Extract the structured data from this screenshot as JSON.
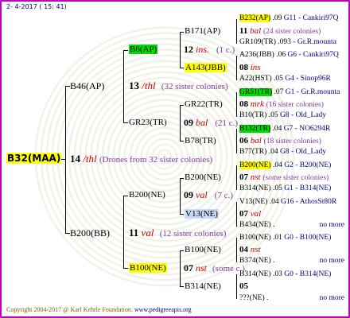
{
  "header": {
    "date": "2- 4-2017 ( 15: 41)"
  },
  "footer": {
    "copyright": "Copyright 2004-2017 @ Karl Kehrle Foundation.",
    "url": "www.pedigreeapis.org"
  },
  "colors": {
    "border": "#c000c0",
    "highlight_yellow": "#ffff00",
    "highlight_green": "#00dd00",
    "ins_red": "#d00000",
    "sister_purple": "#7a3a9a",
    "link_navy": "#000080"
  },
  "root": {
    "id": "B32(MAA)",
    "year": "14",
    "ins": "/thl",
    "note": "(Drones from 32 sister colonies)"
  },
  "gen1": {
    "top": {
      "id": "B46(AP)",
      "year": "13",
      "ins": "/thl",
      "note": "(32 sister colonies)"
    },
    "bottom": {
      "id": "B200(BB)",
      "year": "11",
      "ins": "val",
      "note": "(12 sister colonies)"
    }
  },
  "gen2": {
    "a": {
      "id": "B6(AP)",
      "year": "12",
      "ins": "ins.",
      "note": "(1 c.)"
    },
    "b": {
      "id": "GR23(TR)",
      "year": "09",
      "ins": "bal",
      "note": "(21 c.)"
    },
    "c": {
      "id": "B200(NE)",
      "year": "09",
      "ins": "val",
      "note": "(7 c.)"
    },
    "d": {
      "id": "B100(NE)",
      "year": "07",
      "ins": "nst",
      "note": "(some c.)"
    }
  },
  "gen3": {
    "a1": {
      "id": "B171(AP)",
      "year": "11",
      "ins": "bal",
      "note": "(24 sister colonies)"
    },
    "a2": {
      "id": "A143(JBB)",
      "year": "08",
      "ins": "ins",
      "note": ""
    },
    "b1": {
      "id": "GR22(TR)",
      "year": "08",
      "ins": "mrk",
      "note": "(16 sister colonies)"
    },
    "b2": {
      "id": "B78(TR)",
      "year": "06",
      "ins": "bal",
      "note": "(18 sister colonies)"
    },
    "c1": {
      "id": "B200(NE)",
      "year": "07",
      "ins": "nst",
      "note": "(some sister colonies)"
    },
    "c2": {
      "id": "V13(NE)",
      "year": "07",
      "ins": "val",
      "note": ""
    },
    "d1": {
      "id": "B100(NE)",
      "year": "04",
      "ins": "nst",
      "note": ""
    },
    "d2": {
      "id": "B314(NE)",
      "year": "05",
      "ins": "",
      "note": ""
    }
  },
  "gen4": [
    {
      "id": "B232(AP)",
      "num": ".09",
      "loc": "G11 - Cankiri97Q"
    },
    {
      "id": "GR109(TR)",
      "num": ".093",
      "loc": "- Gr.R.mounta"
    },
    {
      "id": "A236(JBB)",
      "num": ".06",
      "loc": "G6 - Cankiri97Q"
    },
    {
      "id": "A22(HST)",
      "num": ".05",
      "loc": "G4 - Sinop96R"
    },
    {
      "id": "GR51(TR)",
      "num": ".07",
      "loc": "G1 - Gr.R.mounta"
    },
    {
      "id": "B10(TR)",
      "num": ".05",
      "loc": "G8 - Old_Lady"
    },
    {
      "id": "B132(TR)",
      "num": ".04",
      "loc": "G7 - NO6294R"
    },
    {
      "id": "B77(TR)",
      "num": ".04",
      "loc": "G8 - Old_Lady"
    },
    {
      "id": "B200(NE)",
      "num": ".04",
      "loc": "G2 - B200(NE)"
    },
    {
      "id": "B314(NE)",
      "num": ".05",
      "loc": "G1 - B314(NE)"
    },
    {
      "id": "V13(NE)",
      "num": ".04",
      "loc": "G16 - AthosSt80R"
    },
    {
      "id": "B434(NE)",
      "num": ".",
      "loc": "no more"
    },
    {
      "id": "B100(NE)",
      "num": ".01",
      "loc": "G0 - B100(NE)"
    },
    {
      "id": "B374(NE)",
      "num": ".",
      "loc": "no more"
    },
    {
      "id": "B314(NE)",
      "num": ".03",
      "loc": "G0 - B314(NE)"
    },
    {
      "id": "???(NE)",
      "num": ".",
      "loc": "no more"
    }
  ]
}
